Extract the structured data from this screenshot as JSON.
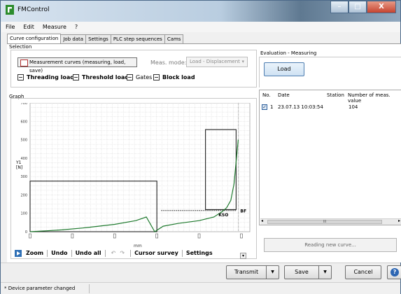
{
  "window": {
    "title": "FMControl",
    "minimize": "–",
    "maximize": "□",
    "close": "X"
  },
  "menu": [
    "File",
    "Edit",
    "Measure",
    "?"
  ],
  "tabs": [
    "Curve configuration",
    "Job data",
    "Settings",
    "PLC step sequences",
    "Cams"
  ],
  "selection": {
    "label": "Selection",
    "meas_curves_button": "Measurement curves (measuring, load, save)",
    "meas_mode_label": "Meas. mode:",
    "meas_mode_value": "Load - Displacement",
    "meas_mode_arrow": "▾",
    "options": [
      "Threading load",
      "Threshold load",
      "Gates",
      "Block load"
    ]
  },
  "graph": {
    "label": "Graph",
    "y_label_top": "Y1",
    "y_label_unit": "[N]",
    "x_label": "mm",
    "markers": [
      "KSO",
      "BF"
    ],
    "toolbar": {
      "zoom": "Zoom",
      "undo": "Undo",
      "undo_all": "Undo all",
      "undo_icon": "↶",
      "redo_icon": "↷",
      "cursor_survey": "Cursor survey",
      "settings": "Settings",
      "collapse": "▾"
    }
  },
  "chart_data": {
    "type": "line",
    "xlabel": "mm",
    "ylabel": "Y1 [N]",
    "yticks": [
      0,
      100,
      200,
      300,
      400,
      500,
      600,
      700
    ],
    "ylim": [
      0,
      700
    ],
    "grid": true,
    "series": [
      {
        "x": [
          0,
          0.8,
          1.5,
          2.5,
          4.0,
          5.0,
          5.5,
          5.9,
          6.3,
          7.0,
          8.0,
          8.7,
          9.1,
          9.3,
          9.5,
          9.65,
          9.75,
          9.85
        ],
        "y": [
          0,
          5,
          10,
          20,
          40,
          60,
          80,
          0,
          30,
          45,
          60,
          80,
          110,
          130,
          170,
          260,
          380,
          500
        ]
      }
    ],
    "gates": [
      {
        "x_range": [
          0,
          6.0
        ],
        "y_range": [
          0,
          275
        ]
      },
      {
        "x_range": [
          8.3,
          9.75
        ],
        "y_range": [
          120,
          555
        ]
      }
    ],
    "threshold_lines": [
      {
        "x_range": [
          6.2,
          9.75
        ],
        "y": 115,
        "label": "KSO"
      }
    ],
    "cursor_lines": [
      {
        "x": 9.85,
        "label": "BF"
      }
    ]
  },
  "evaluation": {
    "label": "Evaluation - Measuring",
    "load_button": "Load",
    "columns": [
      "No.",
      "Date",
      "Station",
      "Number of meas. value"
    ],
    "rows": [
      {
        "check": "✓",
        "no": "1",
        "date": "23.07.13 10:03:54",
        "station": "",
        "count": "104"
      }
    ],
    "scroll_left": "◂",
    "scroll_right": "▸",
    "scroll_thumb": "III",
    "reading_button": "Reading new curve..."
  },
  "buttons": {
    "transmit": "Transmit",
    "save": "Save",
    "cancel": "Cancel",
    "help": "?",
    "dropdown_arrow": "▼"
  },
  "status": {
    "message": "* Device parameter changed"
  },
  "colors": {
    "curve": "#1f7a2e",
    "gate": "#222222",
    "accent": "#2d66b3"
  }
}
